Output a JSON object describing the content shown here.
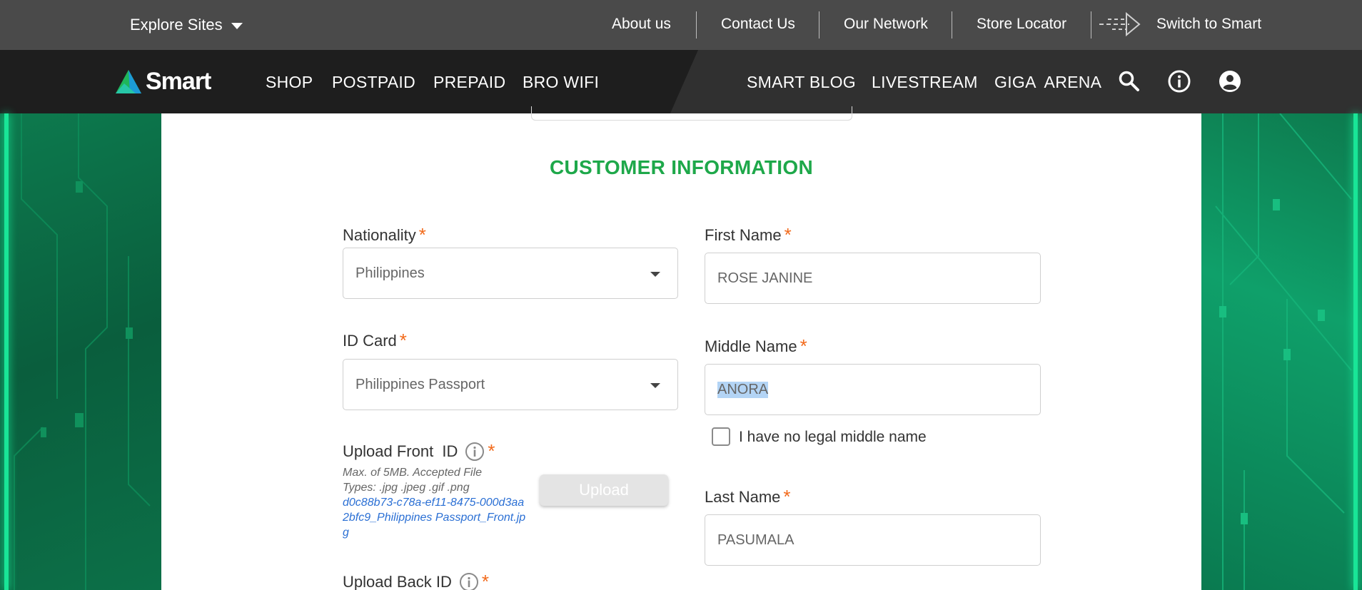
{
  "topbar": {
    "explore_label": "Explore Sites",
    "links": [
      "About us",
      "Contact Us",
      "Our Network",
      "Store Locator"
    ],
    "switch_label": "Switch to Smart"
  },
  "nav": {
    "logo_text": "Smart",
    "left_items": [
      "SHOP",
      "POSTPAID",
      "PREPAID",
      "BRO WIFI"
    ],
    "right_items": [
      "SMART BLOG",
      "LIVESTREAM",
      "GIGA  ARENA"
    ],
    "icons": [
      "search-icon",
      "info-icon",
      "account-icon"
    ]
  },
  "form": {
    "section_title": "CUSTOMER INFORMATION",
    "required_mark": "*",
    "nationality": {
      "label": "Nationality",
      "value": "Philippines"
    },
    "id_card": {
      "label": "ID Card",
      "value": "Philippines Passport"
    },
    "upload_front": {
      "label": "Upload Front  ID",
      "hint": "Max. of 5MB. Accepted File Types: .jpg .jpeg .gif .png",
      "filename": "d0c88b73-c78a-ef11-8475-000d3aa2bfc9_Philippines Passport_Front.jpg",
      "button": "Upload"
    },
    "upload_back": {
      "label": "Upload Back ID"
    },
    "first_name": {
      "label": "First Name",
      "value": "ROSE JANINE"
    },
    "middle_name": {
      "label": "Middle Name",
      "value": "ANORA"
    },
    "no_middle_name": {
      "label": "I have no legal middle name",
      "checked": false
    },
    "last_name": {
      "label": "Last Name",
      "value": "PASUMALA"
    }
  },
  "colors": {
    "accent_green": "#1ea84a",
    "required_orange": "#f26a1b",
    "link_blue": "#2a6fd4"
  }
}
